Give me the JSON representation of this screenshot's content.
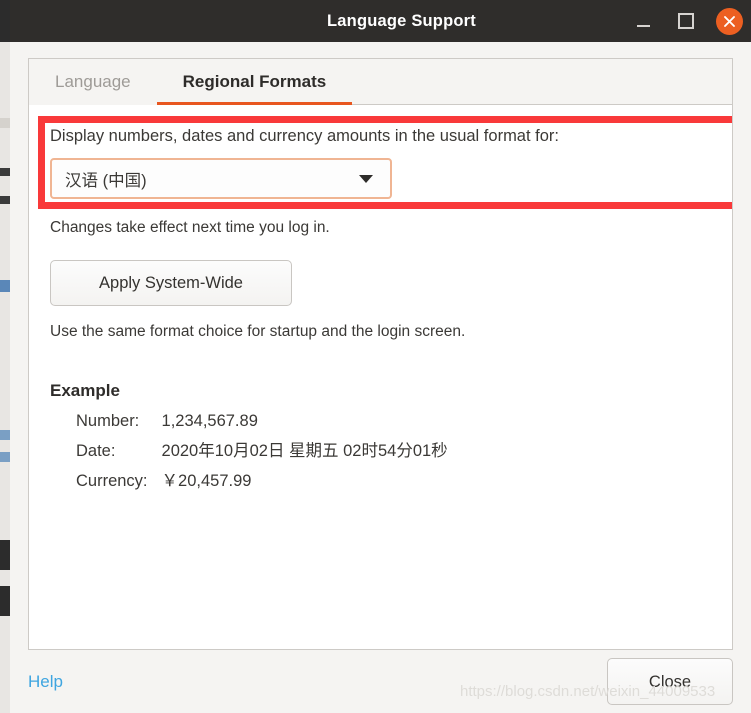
{
  "window": {
    "title": "Language Support",
    "controls": {
      "minimize": "minimize",
      "maximize": "maximize",
      "close": "close"
    }
  },
  "tabs": [
    {
      "label": "Language",
      "active": false
    },
    {
      "label": "Regional Formats",
      "active": true
    }
  ],
  "regional": {
    "prompt": "Display numbers, dates and currency amounts in the usual format for:",
    "locale_selected": "汉语 (中国)",
    "changes_hint": "Changes take effect next time you log in.",
    "apply_button": "Apply System-Wide",
    "apply_hint": "Use the same format choice for startup and the login screen.",
    "example_title": "Example",
    "example_rows": [
      {
        "label": "Number:",
        "value": "1,234,567.89"
      },
      {
        "label": "Date:",
        "value": "2020年10月02日 星期五 02时54分01秒"
      },
      {
        "label": "Currency:",
        "value": "￥20,457.99"
      }
    ]
  },
  "actions": {
    "help": "Help",
    "close": "Close"
  },
  "watermark": "https://blog.csdn.net/weixin_44009533",
  "colors": {
    "titlebar_bg": "#2f2d2b",
    "accent_orange": "#e8561f",
    "close_button_bg": "#ec5f21",
    "annotation_red": "#f9393a",
    "link_blue": "#3fa5e0",
    "focus_border": "#f0b593"
  }
}
